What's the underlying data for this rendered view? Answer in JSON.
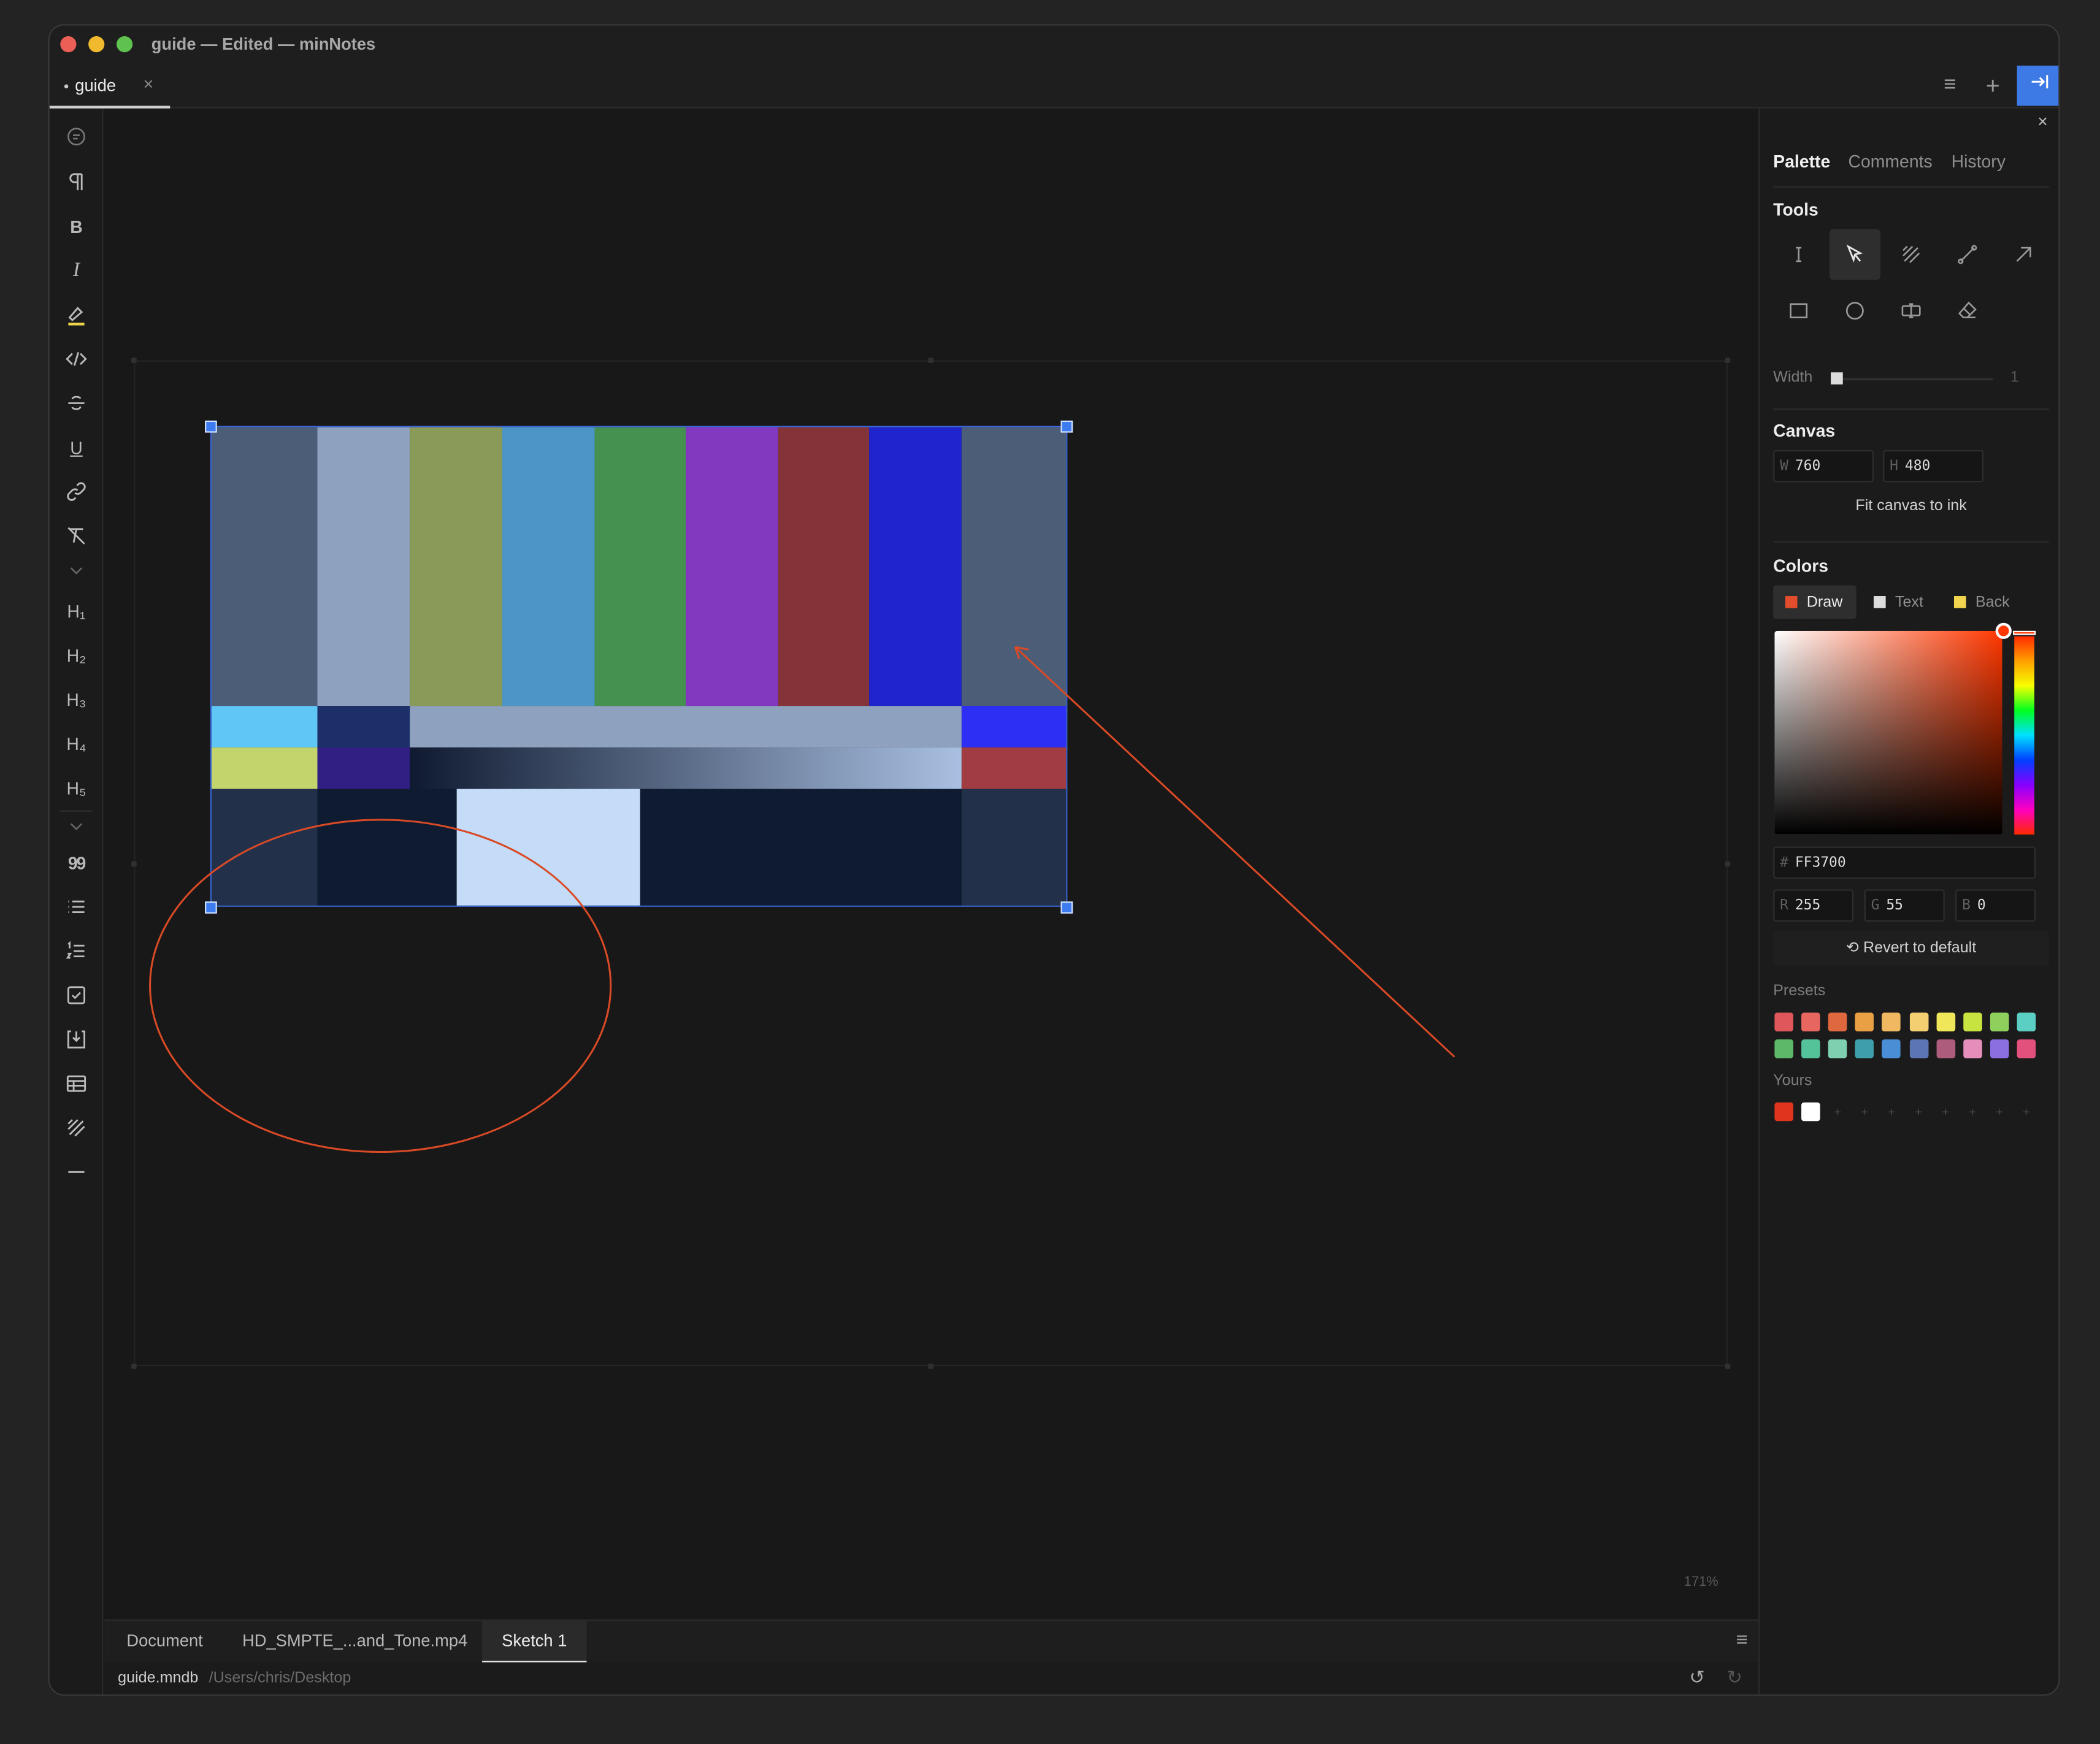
{
  "window": {
    "title": "guide — Edited — minNotes"
  },
  "tabs": [
    {
      "label": "guide",
      "close": "×",
      "modified": true
    }
  ],
  "toolbar": {
    "menu_icon": "≡",
    "add_icon": "+",
    "dock_icon": "→|"
  },
  "left_toolbar": {
    "bold": "B",
    "italic": "I",
    "underline": "U",
    "headings": [
      "H₁",
      "H₂",
      "H₃",
      "H₄",
      "H₅"
    ],
    "quote": "99"
  },
  "canvas": {
    "zoom": "171%"
  },
  "smpte_colors": {
    "top": [
      "#4c5d78",
      "#8ea2c0",
      "#8a9a58",
      "#4b96c6",
      "#45914f",
      "#8239c0",
      "#843339",
      "#2024cc",
      "#4c5d78"
    ],
    "row2": [
      "#5fc6f6",
      "#1c2f68",
      "#8ea2c0",
      "#2d2ff5"
    ],
    "row3_left": [
      "#c2d46b",
      "#321f84"
    ],
    "row3_ramp": [
      "#0f1a30",
      "#a9c0e2"
    ],
    "row3_right": "#a13c42",
    "bottom": [
      "#223049",
      "#0f1b30",
      "#c4dcf8",
      "#0f1b30",
      "#223049"
    ]
  },
  "bottom_tabs": [
    {
      "label": "Document",
      "active": false
    },
    {
      "label": "HD_SMPTE_...and_Tone.mp4",
      "active": false
    },
    {
      "label": "Sketch 1",
      "active": true
    }
  ],
  "status": {
    "file": "guide.mndb",
    "path": "/Users/chris/Desktop"
  },
  "inspector": {
    "close": "×",
    "tabs": [
      {
        "label": "Palette",
        "active": true
      },
      {
        "label": "Comments",
        "active": false
      },
      {
        "label": "History",
        "active": false
      }
    ],
    "tools_heading": "Tools",
    "width_label": "Width",
    "width_value": "1",
    "width_fraction": 0.0,
    "canvas_heading": "Canvas",
    "canvas_w_prefix": "W",
    "canvas_w": "760",
    "canvas_h_prefix": "H",
    "canvas_h": "480",
    "fit_label": "Fit canvas to ink",
    "colors_heading": "Colors",
    "color_tabs": [
      {
        "label": "Draw",
        "color": "#e44d2c",
        "active": true
      },
      {
        "label": "Text",
        "color": "#dddddd",
        "active": false
      },
      {
        "label": "Back",
        "color": "#f2d54e",
        "active": false
      }
    ],
    "hex_prefix": "#",
    "hex": "FF3700",
    "r_prefix": "R",
    "r": "255",
    "g_prefix": "G",
    "g": "55",
    "b_prefix": "B",
    "b": "0",
    "revert_label": "Revert to default",
    "presets_label": "Presets",
    "presets": [
      "#e0575b",
      "#e7665f",
      "#e0683f",
      "#e9a044",
      "#f0b860",
      "#f3cf72",
      "#efe65a",
      "#c6e33f",
      "#8fcf5c",
      "#5ccfc4",
      "#5db86a",
      "#55c39a",
      "#7ed0b0",
      "#3e9eaa",
      "#4a8ed6",
      "#5c76b5",
      "#ad5c7c",
      "#e58ebc",
      "#8b6ee0",
      "#e2517c"
    ],
    "yours_label": "Yours",
    "yours": [
      "#e0351c",
      "#ffffff"
    ],
    "yours_empty": "+"
  }
}
